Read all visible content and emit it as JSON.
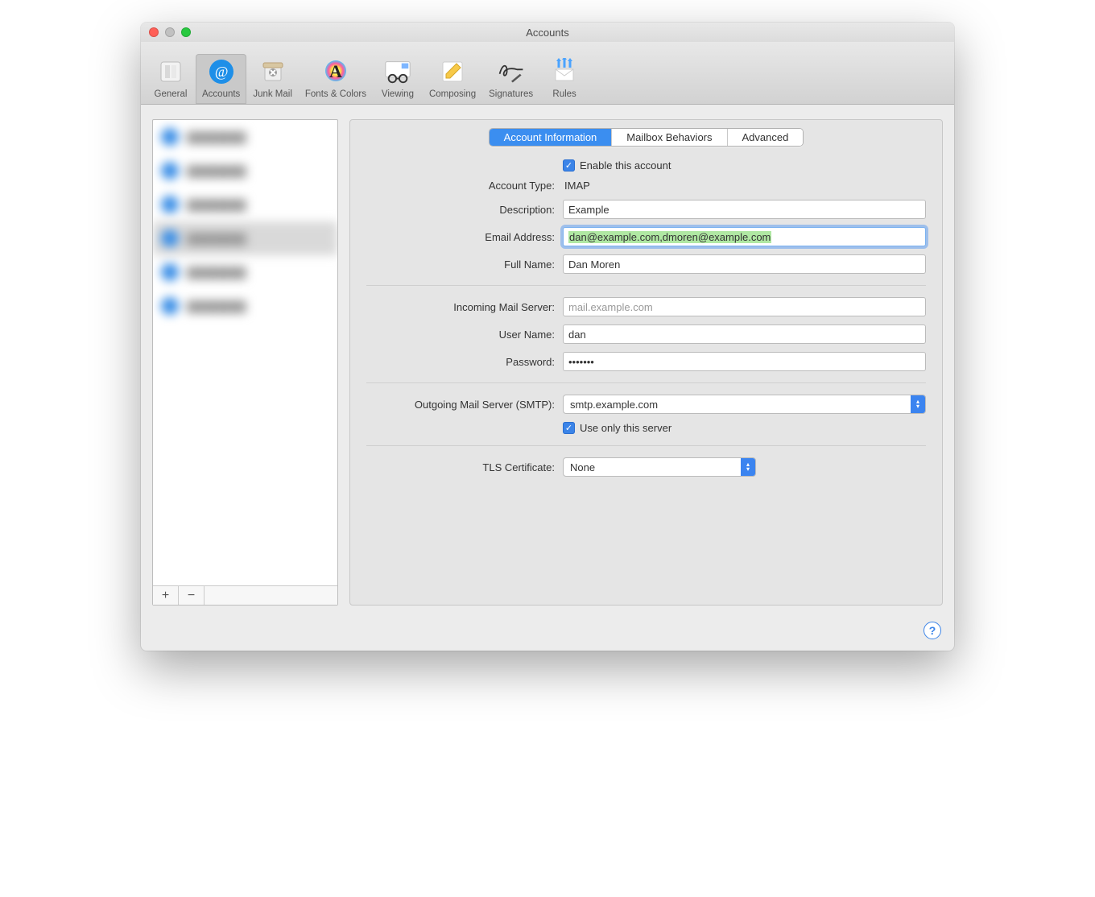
{
  "window": {
    "title": "Accounts"
  },
  "toolbar": {
    "items": [
      {
        "label": "General"
      },
      {
        "label": "Accounts"
      },
      {
        "label": "Junk Mail"
      },
      {
        "label": "Fonts & Colors"
      },
      {
        "label": "Viewing"
      },
      {
        "label": "Composing"
      },
      {
        "label": "Signatures"
      },
      {
        "label": "Rules"
      }
    ],
    "active_index": 1
  },
  "tabs": {
    "items": [
      "Account Information",
      "Mailbox Behaviors",
      "Advanced"
    ],
    "active_index": 0
  },
  "form": {
    "enable_label": "Enable this account",
    "enable_checked": true,
    "account_type_label": "Account Type:",
    "account_type_value": "IMAP",
    "description_label": "Description:",
    "description_value": "Example",
    "email_label": "Email Address:",
    "email_value": "dan@example.com,dmoren@example.com",
    "fullname_label": "Full Name:",
    "fullname_value": "Dan Moren",
    "incoming_label": "Incoming Mail Server:",
    "incoming_value": "mail.example.com",
    "username_label": "User Name:",
    "username_value": "dan",
    "password_label": "Password:",
    "password_value": "•••••••",
    "smtp_label": "Outgoing Mail Server (SMTP):",
    "smtp_value": "smtp.example.com",
    "use_only_label": "Use only this server",
    "use_only_checked": true,
    "tls_label": "TLS Certificate:",
    "tls_value": "None"
  },
  "sidebar": {
    "add_label": "+",
    "remove_label": "−"
  },
  "help_label": "?",
  "colors": {
    "accent": "#3b84e8",
    "highlight": "#b0e8a3"
  }
}
